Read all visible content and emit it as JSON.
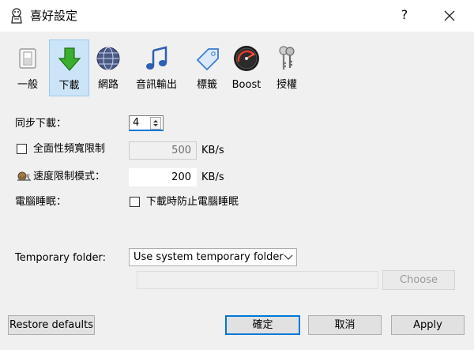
{
  "window": {
    "title": "喜好設定",
    "help_label": "?",
    "close_icon": "close-icon"
  },
  "toolbar": {
    "items": [
      {
        "label": "一般",
        "icon": "switch-icon",
        "selected": false
      },
      {
        "label": "下載",
        "icon": "download-arrow-icon",
        "selected": true
      },
      {
        "label": "網路",
        "icon": "globe-icon",
        "selected": false
      },
      {
        "label": "音訊輸出",
        "icon": "music-note-icon",
        "selected": false
      },
      {
        "label": "標籤",
        "icon": "tag-icon",
        "selected": false
      },
      {
        "label": "Boost",
        "icon": "gauge-icon",
        "selected": false
      },
      {
        "label": "授權",
        "icon": "keys-icon",
        "selected": false
      }
    ]
  },
  "form": {
    "sync_downloads": {
      "label": "同步下載：",
      "value": "4"
    },
    "global_limit": {
      "label": "全面性頻寬限制",
      "checked": false,
      "value": "500",
      "unit": "KB/s"
    },
    "speed_limit_mode": {
      "label": "速度限制模式：",
      "value": "200",
      "unit": "KB/s",
      "icon": "snail-icon"
    },
    "sleep": {
      "label": "電腦睡眠：",
      "checkbox_label": "下載時防止電腦睡眠",
      "checked": false
    },
    "temp_folder": {
      "label": "Temporary folder:",
      "selected": "Use system temporary folder",
      "path": "",
      "choose_label": "Choose"
    }
  },
  "buttons": {
    "restore": "Restore defaults",
    "ok": "確定",
    "cancel": "取消",
    "apply": "Apply"
  },
  "colors": {
    "accent": "#0078d7",
    "selected_bg": "#cce4f7",
    "dialog_bg": "#f0f0f0"
  }
}
